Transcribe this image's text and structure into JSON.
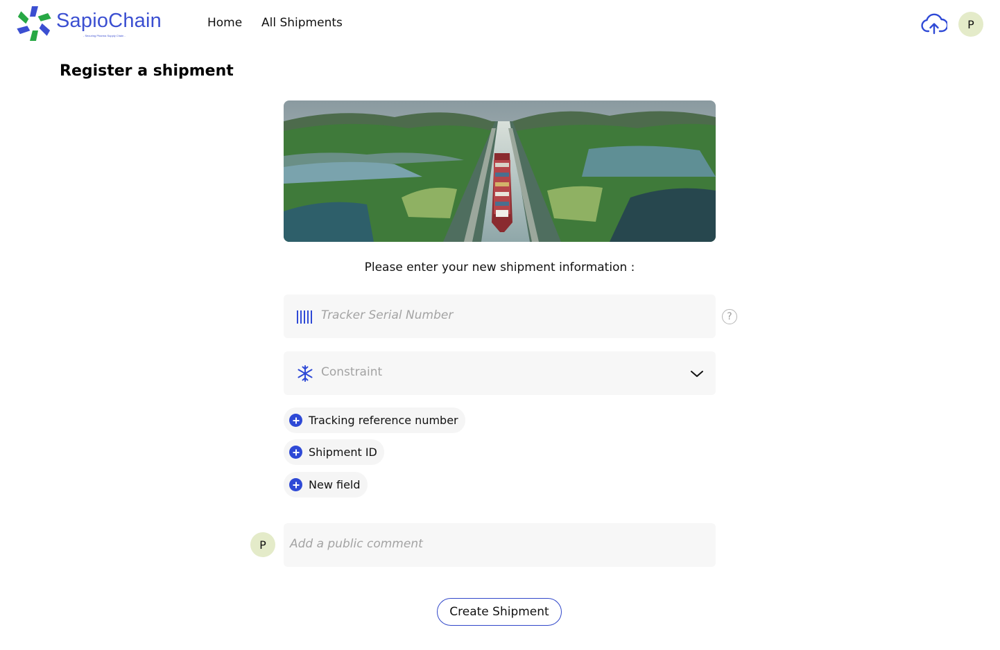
{
  "header": {
    "logo_text": "SapioChain",
    "logo_tagline": "- Securing Pharma Supply Chain -",
    "nav": [
      {
        "label": "Home"
      },
      {
        "label": "All Shipments"
      }
    ],
    "upload_icon": "cloud-upload-icon",
    "user_initial": "P"
  },
  "page": {
    "title": "Register a shipment",
    "hero_image": "aerial view of a container ship passing through canal locks",
    "intro": "Please enter your new shipment information :"
  },
  "form": {
    "tracker": {
      "icon": "barcode-icon",
      "placeholder": "Tracker Serial Number",
      "help_icon": "question-icon",
      "help_glyph": "?"
    },
    "constraint": {
      "icon": "snowflake-icon",
      "placeholder": "Constraint",
      "chevron_icon": "chevron-down-icon"
    },
    "optional_fields": [
      {
        "label": "Tracking reference number",
        "icon": "add-circle-icon"
      },
      {
        "label": "Shipment ID",
        "icon": "add-circle-icon"
      },
      {
        "label": "New field",
        "icon": "add-circle-icon"
      }
    ],
    "comment": {
      "avatar_initial": "P",
      "placeholder": "Add a public comment"
    },
    "submit_label": "Create Shipment"
  },
  "colors": {
    "accent": "#2e49d6",
    "logo_blue": "#3b4fd1",
    "logo_green": "#27a844",
    "avatar_bg": "#e4ebc9",
    "field_bg": "#f7f7f7"
  }
}
